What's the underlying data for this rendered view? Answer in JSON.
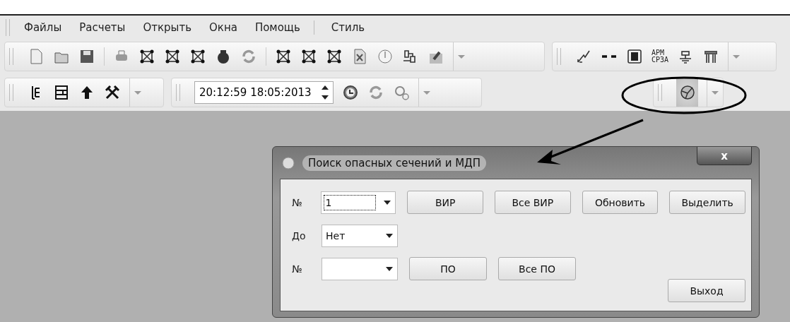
{
  "menu": [
    {
      "label": "Файлы",
      "kind": "item"
    },
    {
      "label": "Расчеты",
      "kind": "item"
    },
    {
      "label": "Открыть",
      "kind": "item"
    },
    {
      "label": "Окна",
      "kind": "item"
    },
    {
      "label": "Помощь",
      "kind": "item"
    },
    {
      "label": "Стиль",
      "kind": "item",
      "separator_before": true
    }
  ],
  "toolbar": {
    "arm_label": [
      "АРМ",
      "СРЗА"
    ]
  },
  "time_field": {
    "value": "20:12:59  18:05:2013"
  },
  "search_tool": {
    "pressed": true
  },
  "dialog": {
    "title": "Поиск опасных сечений и МДП",
    "close": "x",
    "rows": [
      {
        "label": "№",
        "combo": "1",
        "focused": true,
        "buttons": [
          "ВИР",
          "Все ВИР",
          "Обновить",
          "Выделить"
        ]
      },
      {
        "label": "До",
        "combo": "Нет",
        "focused": false,
        "buttons": []
      },
      {
        "label": "№",
        "combo": "",
        "focused": false,
        "buttons": [
          "ПО",
          "Все ПО"
        ]
      }
    ],
    "exit": "Выход"
  }
}
